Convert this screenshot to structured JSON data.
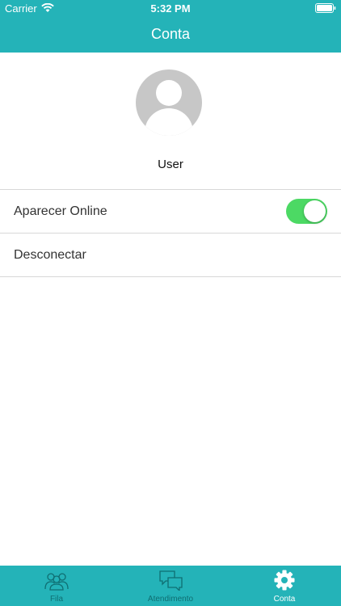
{
  "status_bar": {
    "carrier": "Carrier",
    "time": "5:32 PM"
  },
  "nav": {
    "title": "Conta"
  },
  "profile": {
    "username": "User"
  },
  "settings": {
    "online_label": "Aparecer Online",
    "online_enabled": true,
    "disconnect_label": "Desconectar"
  },
  "tabbar": {
    "tabs": [
      {
        "label": "Fila",
        "icon": "people-icon",
        "active": false
      },
      {
        "label": "Atendimento",
        "icon": "chat-bubbles-icon",
        "active": false
      },
      {
        "label": "Conta",
        "icon": "gear-icon",
        "active": true
      }
    ]
  },
  "colors": {
    "brand": "#24b3b8",
    "toggle_on": "#4cd964",
    "inactive_tab": "#0f6e72"
  }
}
